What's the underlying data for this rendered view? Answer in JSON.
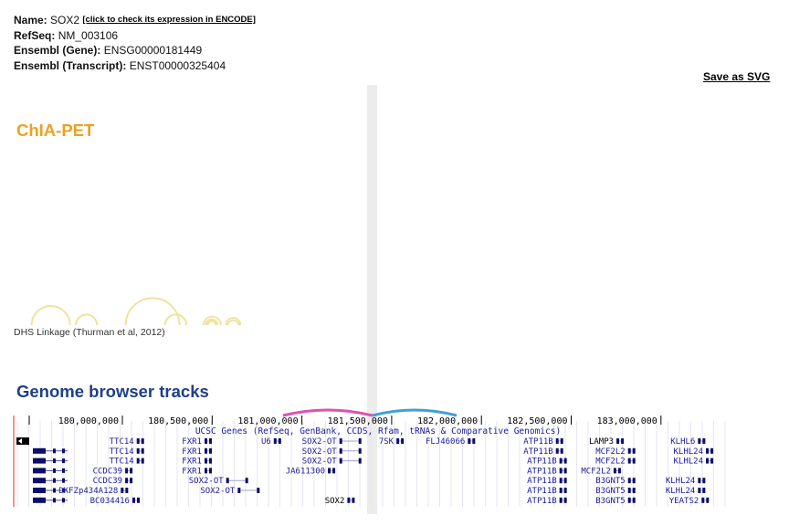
{
  "gene_info": {
    "name_label": "Name:",
    "name_value": "SOX2",
    "encode_link": "[click to check its expression in ENCODE]",
    "refseq_label": "RefSeq:",
    "refseq_value": "NM_003106",
    "ensembl_gene_label": "Ensembl (Gene):",
    "ensembl_gene_value": "ENSG00000181449",
    "ensembl_transcript_label": "Ensembl (Transcript):",
    "ensembl_transcript_value": "ENST00000325404"
  },
  "save_svg_label": "Save as SVG",
  "chiapet": {
    "title": "ChIA-PET",
    "arc_color": "#efe3a0",
    "dhs_label": "DHS Linkage (Thurman et al, 2012)",
    "arcs": [
      {
        "start": 179.72,
        "end": 181.06
      },
      {
        "start": 181.26,
        "end": 182.0
      },
      {
        "start": 183.0,
        "end": 184.88
      },
      {
        "start": 184.38,
        "end": 185.12
      },
      {
        "start": 185.72,
        "end": 186.32
      },
      {
        "start": 185.8,
        "end": 186.2
      },
      {
        "start": 185.86,
        "end": 186.14
      },
      {
        "start": 186.5,
        "end": 187.0
      },
      {
        "start": 186.56,
        "end": 186.94
      }
    ]
  },
  "genome_browser": {
    "title": "Genome browser tracks",
    "ruler_ticks": [
      "180,000,000",
      "180,500,000",
      "181,000,000",
      "181,500,000",
      "182,000,000",
      "182,500,000",
      "183,000,000"
    ],
    "track_title": "UCSC Genes (RefSeq, GenBank, CCDS, Rfam, tRNAs & Comparative Genomics)",
    "highlight_colors": [
      "#e050b0",
      "#40a0d8"
    ],
    "gene_labels": [
      {
        "text": "TTC14",
        "row": 0,
        "pos": 0.168
      },
      {
        "text": "FXR1",
        "row": 0,
        "pos": 0.262
      },
      {
        "text": "U6",
        "row": 0,
        "pos": 0.358
      },
      {
        "text": "SOX2-OT",
        "row": 0,
        "pos": 0.449
      },
      {
        "text": "7SK",
        "row": 0,
        "pos": 0.528
      },
      {
        "text": "FLJ46066",
        "row": 0,
        "pos": 0.627
      },
      {
        "text": "ATP11B",
        "row": 0,
        "pos": 0.749
      },
      {
        "text": "LAMP3",
        "row": 0,
        "pos": 0.833
      },
      {
        "text": "KLHL6",
        "row": 0,
        "pos": 0.946
      },
      {
        "text": "TTC14",
        "row": 1,
        "pos": 0.168
      },
      {
        "text": "FXR1",
        "row": 1,
        "pos": 0.262
      },
      {
        "text": "SOX2-OT",
        "row": 1,
        "pos": 0.449
      },
      {
        "text": "ATP11B",
        "row": 1,
        "pos": 0.749
      },
      {
        "text": "MCF2L2",
        "row": 1,
        "pos": 0.849
      },
      {
        "text": "KLHL24",
        "row": 1,
        "pos": 0.957
      },
      {
        "text": "TTC14",
        "row": 2,
        "pos": 0.168
      },
      {
        "text": "FXR1",
        "row": 2,
        "pos": 0.262
      },
      {
        "text": "SOX2-OT",
        "row": 2,
        "pos": 0.449
      },
      {
        "text": "ATP11B",
        "row": 2,
        "pos": 0.754
      },
      {
        "text": "MCF2L2",
        "row": 2,
        "pos": 0.849
      },
      {
        "text": "KLHL24",
        "row": 2,
        "pos": 0.957
      },
      {
        "text": "CCDC39",
        "row": 3,
        "pos": 0.152
      },
      {
        "text": "FXR1",
        "row": 3,
        "pos": 0.262
      },
      {
        "text": "JA611300",
        "row": 3,
        "pos": 0.433
      },
      {
        "text": "ATP11B",
        "row": 3,
        "pos": 0.754
      },
      {
        "text": "MCF2L2",
        "row": 3,
        "pos": 0.829
      },
      {
        "text": "KLHL24",
        "row": 4,
        "pos": 0.946
      },
      {
        "text": "CCDC39",
        "row": 4,
        "pos": 0.152
      },
      {
        "text": "SOX2-OT",
        "row": 4,
        "pos": 0.292
      },
      {
        "text": "ATP11B",
        "row": 4,
        "pos": 0.754
      },
      {
        "text": "B3GNT5",
        "row": 4,
        "pos": 0.849
      },
      {
        "text": "DKFZp434A128",
        "row": 5,
        "pos": 0.146
      },
      {
        "text": "SOX2-OT",
        "row": 5,
        "pos": 0.308
      },
      {
        "text": "ATP11B",
        "row": 5,
        "pos": 0.754
      },
      {
        "text": "B3GNT5",
        "row": 5,
        "pos": 0.849
      },
      {
        "text": "KLHL24",
        "row": 5,
        "pos": 0.946
      },
      {
        "text": "BC034416",
        "row": 6,
        "pos": 0.162
      },
      {
        "text": "SOX2",
        "row": 6,
        "pos": 0.46
      },
      {
        "text": "ATP11B",
        "row": 6,
        "pos": 0.754
      },
      {
        "text": "B3GNT5",
        "row": 6,
        "pos": 0.849
      },
      {
        "text": "YEATS2",
        "row": 6,
        "pos": 0.951
      }
    ]
  }
}
